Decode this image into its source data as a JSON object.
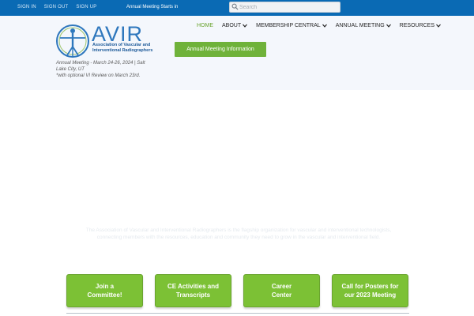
{
  "topbar": {
    "links": [
      "SIGN IN",
      "SIGN OUT",
      "SIGN UP"
    ],
    "countdown_label": "Annual Meeting Starts in",
    "search_placeholder": "Search"
  },
  "logo": {
    "word": "AVIR",
    "subtitle_line1": "Association of Vascular and",
    "subtitle_line2": "Interventional Radiographers"
  },
  "meeting_note": {
    "line1": "Annual Meeting - March 24-26, 2024 | Salt Lake City, UT",
    "line2": "*with optional VI Review on March 23rd."
  },
  "nav": {
    "items": [
      {
        "label": "HOME",
        "active": true,
        "has_dropdown": false
      },
      {
        "label": "ABOUT",
        "active": false,
        "has_dropdown": true
      },
      {
        "label": "MEMBERSHIP CENTRAL",
        "active": false,
        "has_dropdown": true
      },
      {
        "label": "ANNUAL MEETING",
        "active": false,
        "has_dropdown": true
      },
      {
        "label": "RESOURCES",
        "active": false,
        "has_dropdown": true
      }
    ]
  },
  "info_button": {
    "label": "Annual Meeting Information"
  },
  "hero": {
    "text": "The Association of Vascular and Interventional Radiographers is the flagship organization for vascular and interventional technologists, connecting members with the resources, education and community they need to grow in the vascular and interventional field."
  },
  "actions": [
    {
      "line1": "Join a",
      "line2": "Committee!"
    },
    {
      "line1": "CE Activities and",
      "line2": "Transcripts"
    },
    {
      "line1": "Career",
      "line2": "Center"
    },
    {
      "line1": "Call for Posters for",
      "line2": "our 2023 Meeting"
    }
  ],
  "colors": {
    "topbar": "#0a6ab4",
    "header_bg": "#f4f7fc",
    "brand_blue": "#2e77bd",
    "accent_green": "#6fb23a",
    "action_green": "#7cc135"
  }
}
